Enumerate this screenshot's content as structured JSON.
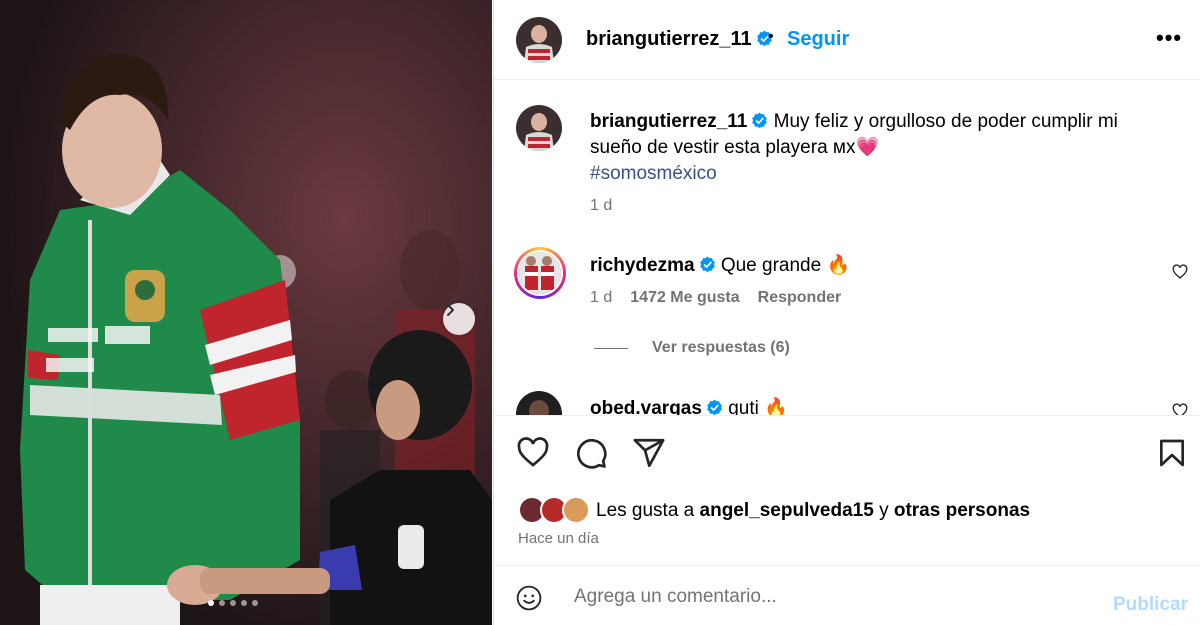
{
  "post": {
    "username": "briangutierrez_11",
    "bullet": "•",
    "follow_label": "Seguir",
    "more_label": "•••",
    "caption_user": "briangutierrez_11",
    "caption_text": "Muy feliz y orgulloso de poder cumplir mi sueño de vestir esta playera мх💗",
    "hashtag": "#somosméxico",
    "caption_time": "1 d",
    "carousel": {
      "count": 5,
      "active_index": 0
    }
  },
  "comments": [
    {
      "username": "richydezma",
      "text": "Que grande 🔥",
      "time": "1 d",
      "likes": "1472 Me gusta",
      "reply_label": "Responder",
      "view_replies": "Ver respuestas (6)"
    },
    {
      "username": "obed.vargas",
      "text": "guti 🔥"
    }
  ],
  "actions": {
    "icons": [
      "heart-icon",
      "comment-icon",
      "share-icon",
      "bookmark-icon"
    ],
    "likes_prefix": "Les gusta a",
    "likes_user": "angel_sepulveda15",
    "likes_and": "y",
    "likes_others": "otras personas",
    "post_time": "Hace un día"
  },
  "comment_box": {
    "placeholder": "Agrega un comentario...",
    "publish_label": "Publicar"
  },
  "colors": {
    "accent": "#0095f6",
    "publish_disabled": "#b3dbff",
    "hashtag": "#385185",
    "muted": "#737373"
  }
}
